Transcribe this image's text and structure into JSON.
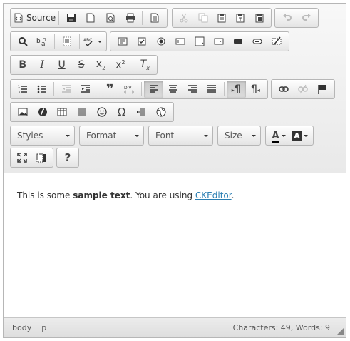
{
  "toolbar": {
    "source_label": "Source",
    "paragraph_mark": "¶",
    "ltr_mark": "¶",
    "omega": "Ω",
    "div_label": "DIV",
    "help_label": "?",
    "bold_label": "B",
    "italic_label": "I",
    "underline_label": "U",
    "strike_label": "S",
    "sub_label": "x",
    "sub_index": "2",
    "sup_label": "x",
    "sup_index": "2",
    "removeformat_label": "T",
    "removeformat_sub": "x",
    "textcolor_label": "A",
    "bgcolor_label": "A",
    "spell_label": "ABC",
    "state": {
      "active_buttons": [
        "align-left",
        "direction-ltr"
      ],
      "disabled_buttons": [
        "cut",
        "copy",
        "undo",
        "redo",
        "indent-decrease",
        "unlink"
      ]
    }
  },
  "combos": {
    "styles": "Styles",
    "format": "Format",
    "font": "Font",
    "size": "Size"
  },
  "content": {
    "text_before": "This is some ",
    "bold_text": "sample text",
    "text_middle": ". You are using ",
    "link_text": "CKEditor",
    "text_after": "."
  },
  "statusbar": {
    "path": [
      "body",
      "p"
    ],
    "counter": "Characters: 49, Words: 9"
  },
  "colors": {
    "link": "#2b7fb3",
    "toolbar_bg": "#e9e9e9",
    "border": "#b6b6b6",
    "textcolor_bar": "#000000"
  }
}
